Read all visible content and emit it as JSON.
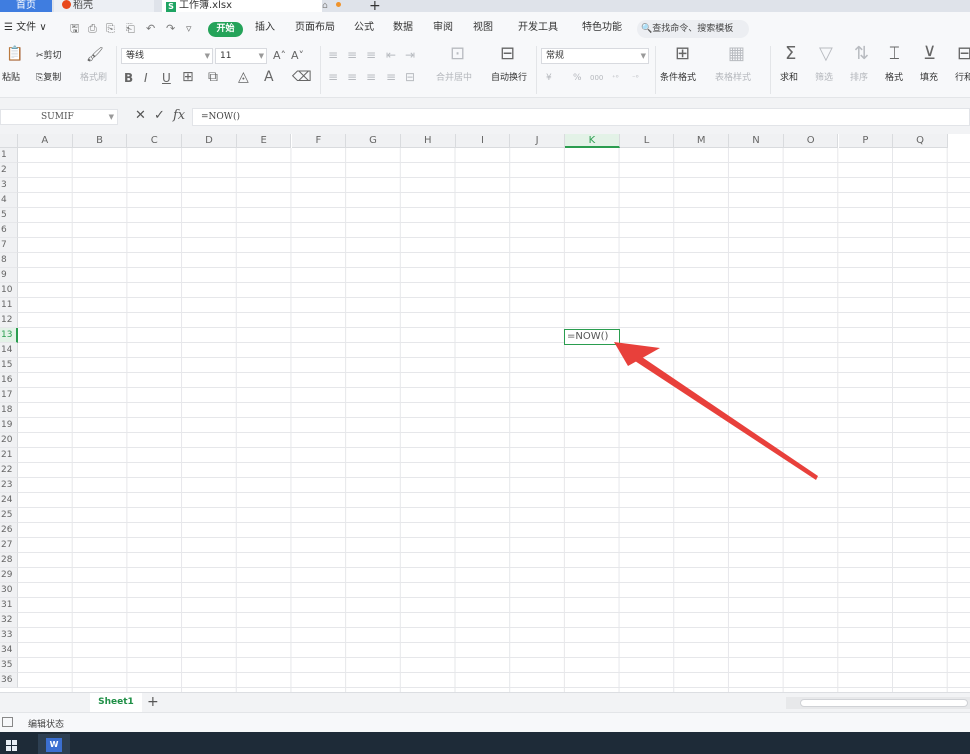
{
  "tabs": {
    "home": "首页",
    "daoke": "稻壳",
    "file": "工作簿.xlsx",
    "file_icon": "S"
  },
  "menu": {
    "file": "☰ 文件 ∨",
    "start": "开始",
    "items": [
      "插入",
      "页面布局",
      "公式",
      "数据",
      "审阅",
      "视图",
      "开发工具",
      "特色功能"
    ],
    "search": "查找命令、搜索模板"
  },
  "ribbon": {
    "paste": "粘贴",
    "cut": "剪切",
    "copy": "复制",
    "format_painter": "格式刷",
    "font_name": "等线",
    "font_size": "11",
    "bold": "B",
    "italic": "I",
    "underline": "U",
    "merge_center": "合并居中",
    "wrap_text": "自动换行",
    "number_format": "常规",
    "currency": "¥",
    "percent": "%",
    "thousands": "000",
    "cond_format": "条件格式",
    "table_style": "表格样式",
    "sum": "求和",
    "filter": "筛选",
    "sort": "排序",
    "format": "格式",
    "fill": "填充",
    "row_col": "行和"
  },
  "formula_bar": {
    "name_box": "SUMIF",
    "formula": "=NOW()",
    "fx": "fx"
  },
  "columns": [
    "A",
    "B",
    "C",
    "D",
    "E",
    "F",
    "G",
    "H",
    "I",
    "J",
    "K",
    "L",
    "M",
    "N",
    "O",
    "P",
    "Q"
  ],
  "selected_column": "K",
  "rows": [
    "1",
    "2",
    "3",
    "4",
    "5",
    "6",
    "7",
    "8",
    "9",
    "10",
    "11",
    "12",
    "13",
    "14",
    "15",
    "16",
    "17",
    "18",
    "19",
    "20",
    "21",
    "22",
    "23",
    "24",
    "25",
    "26",
    "27",
    "28",
    "29",
    "30",
    "31",
    "32",
    "33",
    "34",
    "35",
    "36"
  ],
  "selected_row": "13",
  "active_cell": {
    "ref": "K13",
    "content": "=NOW()"
  },
  "sheets": {
    "active": "Sheet1",
    "add": "+"
  },
  "status": {
    "text": "编辑状态"
  },
  "taskbar": {
    "wps": "W"
  },
  "colors": {
    "accent": "#25a35a",
    "tab_blue": "#3f7de0",
    "arrow": "#e8403b"
  }
}
